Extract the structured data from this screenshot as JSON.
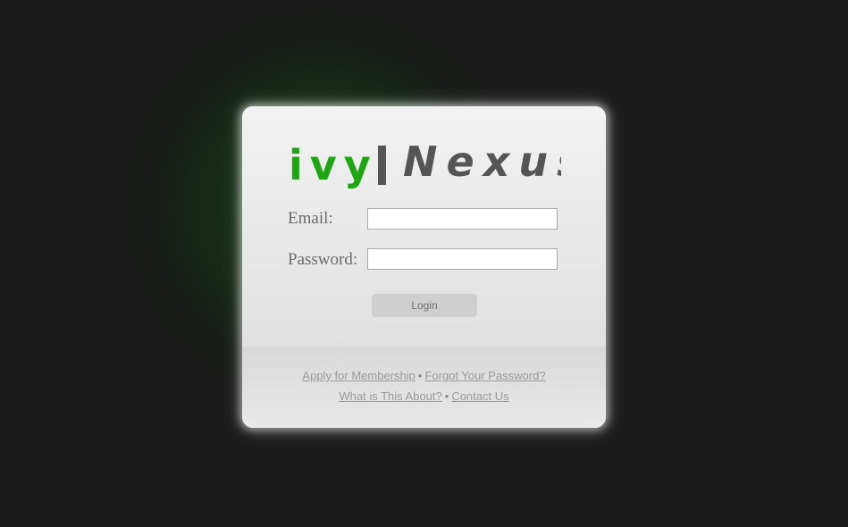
{
  "background": {
    "watermark_text": "",
    "accent_color": "#1fa514"
  },
  "logo": {
    "part1": "ivy",
    "divider": "|",
    "part2": "Nexus",
    "part1_color": "#1fa514",
    "part2_color": "#555555"
  },
  "form": {
    "email_label": "Email:",
    "email_value": "",
    "email_placeholder": "",
    "password_label": "Password:",
    "password_value": "",
    "password_placeholder": "",
    "login_label": "Login"
  },
  "footer_links": {
    "row1": {
      "apply": "Apply for Membership",
      "separator": "•",
      "forgot": "Forgot Your Password?"
    },
    "row2": {
      "about": "What is This About?",
      "separator": "•",
      "contact": "Contact Us"
    }
  }
}
